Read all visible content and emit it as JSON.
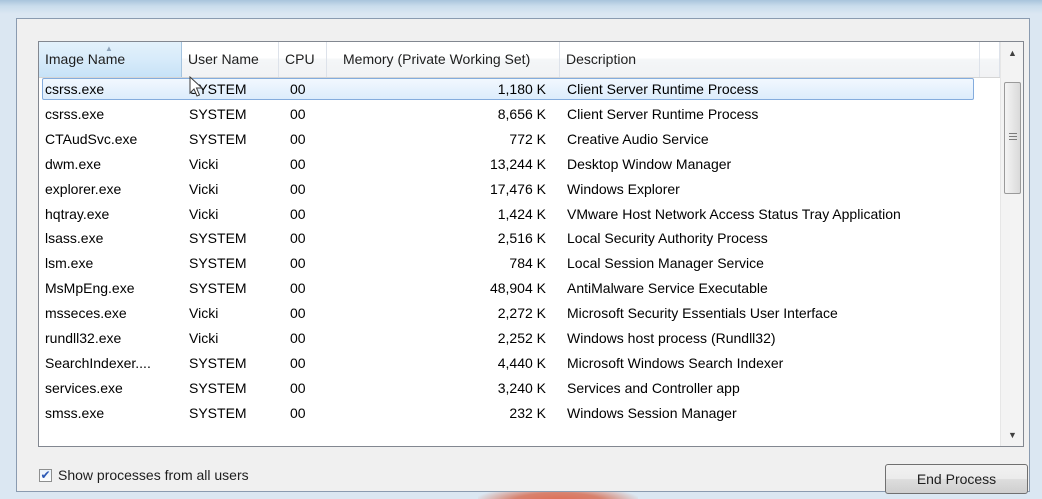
{
  "columns": [
    "Image Name",
    "User Name",
    "CPU",
    "Memory (Private Working Set)",
    "Description"
  ],
  "sorted_column": "Image Name",
  "processes": [
    {
      "name": "csrss.exe",
      "user": "SYSTEM",
      "cpu": "00",
      "memory": "1,180 K",
      "description": "Client Server Runtime Process",
      "selected": true
    },
    {
      "name": "csrss.exe",
      "user": "SYSTEM",
      "cpu": "00",
      "memory": "8,656 K",
      "description": "Client Server Runtime Process"
    },
    {
      "name": "CTAudSvc.exe",
      "user": "SYSTEM",
      "cpu": "00",
      "memory": "772 K",
      "description": "Creative Audio Service"
    },
    {
      "name": "dwm.exe",
      "user": "Vicki",
      "cpu": "00",
      "memory": "13,244 K",
      "description": "Desktop Window Manager"
    },
    {
      "name": "explorer.exe",
      "user": "Vicki",
      "cpu": "00",
      "memory": "17,476 K",
      "description": "Windows Explorer"
    },
    {
      "name": "hqtray.exe",
      "user": "Vicki",
      "cpu": "00",
      "memory": "1,424 K",
      "description": "VMware Host Network Access Status Tray Application"
    },
    {
      "name": "lsass.exe",
      "user": "SYSTEM",
      "cpu": "00",
      "memory": "2,516 K",
      "description": "Local Security Authority Process"
    },
    {
      "name": "lsm.exe",
      "user": "SYSTEM",
      "cpu": "00",
      "memory": "784 K",
      "description": "Local Session Manager Service"
    },
    {
      "name": "MsMpEng.exe",
      "user": "SYSTEM",
      "cpu": "00",
      "memory": "48,904 K",
      "description": "AntiMalware Service Executable"
    },
    {
      "name": "msseces.exe",
      "user": "Vicki",
      "cpu": "00",
      "memory": "2,272 K",
      "description": "Microsoft Security Essentials User Interface"
    },
    {
      "name": "rundll32.exe",
      "user": "Vicki",
      "cpu": "00",
      "memory": "2,252 K",
      "description": "Windows host process (Rundll32)"
    },
    {
      "name": "SearchIndexer....",
      "user": "SYSTEM",
      "cpu": "00",
      "memory": "4,440 K",
      "description": "Microsoft Windows Search Indexer"
    },
    {
      "name": "services.exe",
      "user": "SYSTEM",
      "cpu": "00",
      "memory": "3,240 K",
      "description": "Services and Controller app"
    },
    {
      "name": "smss.exe",
      "user": "SYSTEM",
      "cpu": "00",
      "memory": "232 K",
      "description": "Windows Session Manager"
    }
  ],
  "show_all_users": {
    "label": "Show processes from all users",
    "checked": true
  },
  "end_process_label": "End Process",
  "scrollbar": {
    "position": 0
  }
}
